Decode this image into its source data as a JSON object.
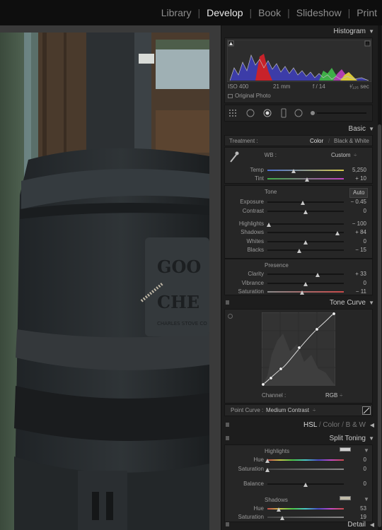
{
  "modules": {
    "items": [
      "Library",
      "Develop",
      "Book",
      "Slideshow",
      "Print"
    ],
    "active": "Develop"
  },
  "histogram": {
    "title": "Histogram",
    "iso": "ISO 400",
    "focal": "21 mm",
    "aperture": "f / 14",
    "shutter": "¹⁄₁₂₅ sec",
    "original_photo_label": "Original Photo"
  },
  "basic": {
    "title": "Basic",
    "treatment_label": "Treatment :",
    "treatment_color": "Color",
    "treatment_bw": "Black & White",
    "wb_label": "WB :",
    "wb_value": "Custom",
    "tone_label": "Tone",
    "auto_label": "Auto",
    "presence_label": "Presence",
    "sliders": [
      {
        "label": "Temp",
        "value": "5,250",
        "pos": 0.34
      },
      {
        "label": "Tint",
        "value": "+ 10",
        "pos": 0.52
      },
      {
        "label": "Exposure",
        "value": "− 0.45",
        "pos": 0.46
      },
      {
        "label": "Contrast",
        "value": "0",
        "pos": 0.5
      },
      {
        "label": "Highlights",
        "value": "− 100",
        "pos": 0.02
      },
      {
        "label": "Shadows",
        "value": "+ 84",
        "pos": 0.92
      },
      {
        "label": "Whites",
        "value": "0",
        "pos": 0.5
      },
      {
        "label": "Blacks",
        "value": "− 15",
        "pos": 0.42
      },
      {
        "label": "Clarity",
        "value": "+ 33",
        "pos": 0.66
      },
      {
        "label": "Vibrance",
        "value": "0",
        "pos": 0.5
      },
      {
        "label": "Saturation",
        "value": "− 11",
        "pos": 0.45
      }
    ]
  },
  "tone_curve": {
    "title": "Tone Curve",
    "channel_label": "Channel :",
    "channel_value": "RGB",
    "point_curve_label": "Point Curve :",
    "point_curve_value": "Medium Contrast"
  },
  "hsl": {
    "hsl": "HSL",
    "sep1": "/",
    "color": "Color",
    "sep2": "/",
    "bw": "B & W"
  },
  "split_toning": {
    "title": "Split Toning",
    "highlights_label": "Highlights",
    "shadows_label": "Shadows",
    "balance_label": "Balance",
    "highlights_hue": {
      "label": "Hue",
      "value": "0",
      "pos": 0.0
    },
    "highlights_sat": {
      "label": "Saturation",
      "value": "0",
      "pos": 0.0
    },
    "balance": {
      "value": "0",
      "pos": 0.5
    },
    "shadows_hue": {
      "label": "Hue",
      "value": "53",
      "pos": 0.15
    },
    "shadows_sat": {
      "label": "Saturation",
      "value": "19",
      "pos": 0.19
    }
  },
  "detail": {
    "title": "Detail"
  },
  "colors": {
    "panel": "#1d1d1d",
    "box": "#262626",
    "active": "#e9e9e9"
  }
}
